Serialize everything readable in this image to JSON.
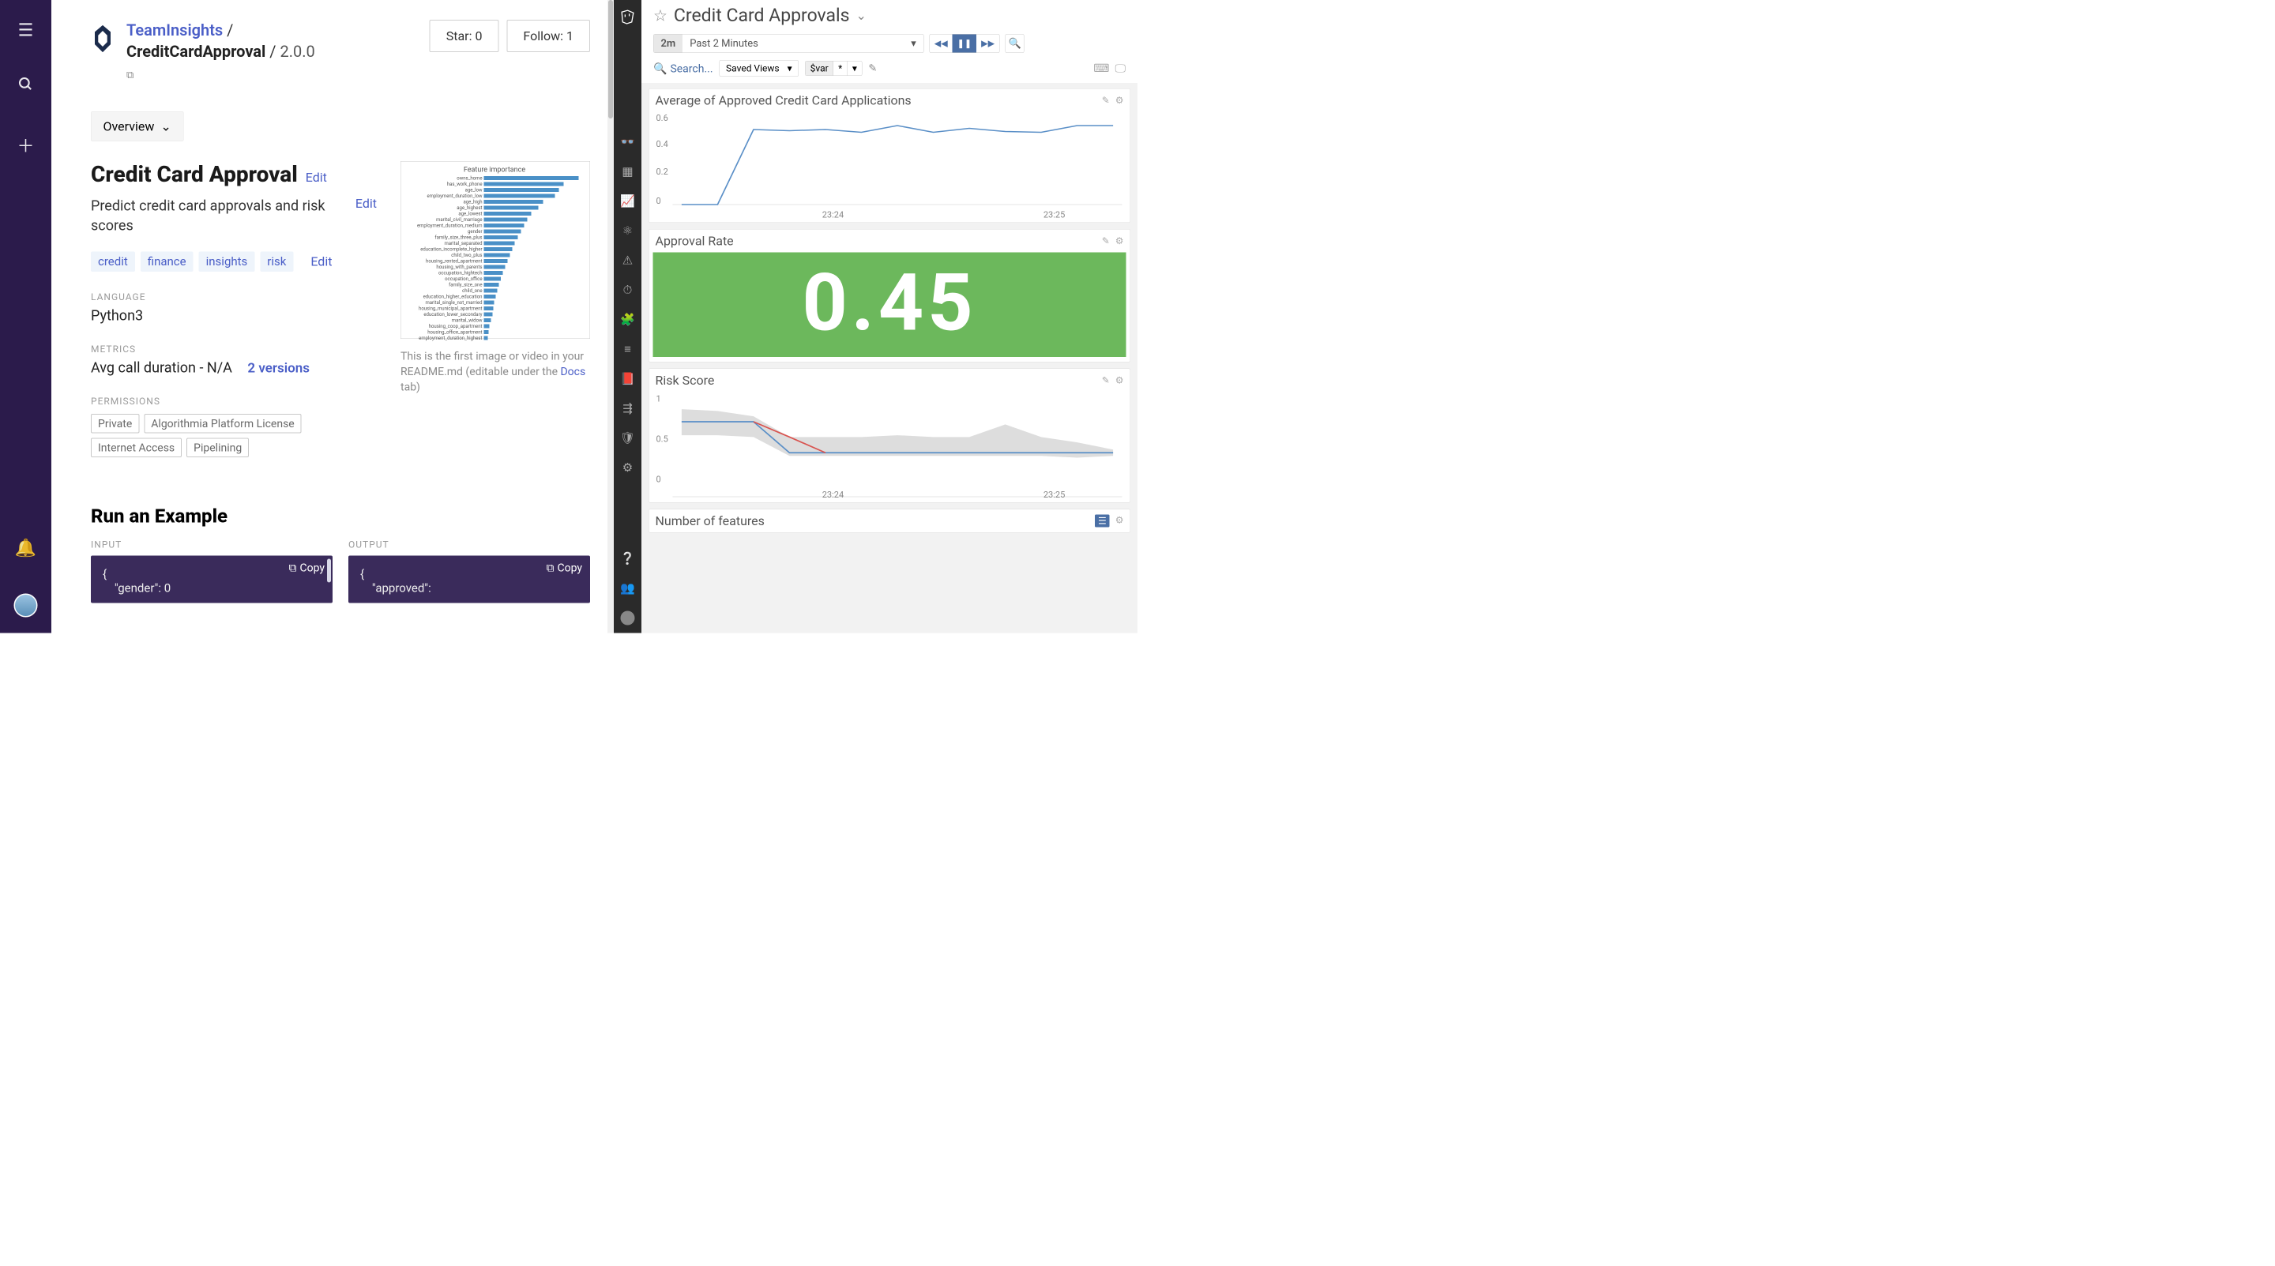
{
  "leftApp": {
    "breadcrumb": {
      "org": "TeamInsights",
      "sep": "/",
      "name": "CreditCardApproval",
      "version": "2.0.0"
    },
    "buttons": {
      "star": "Star: 0",
      "follow": "Follow: 1"
    },
    "overview_label": "Overview",
    "title": "Credit Card Approval",
    "edit": "Edit",
    "description": "Predict credit card approvals and risk scores",
    "tags": [
      "credit",
      "finance",
      "insights",
      "risk"
    ],
    "labels": {
      "language": "LANGUAGE",
      "metrics": "METRICS",
      "permissions": "PERMISSIONS",
      "input": "INPUT",
      "output": "OUTPUT"
    },
    "language": "Python3",
    "metrics_text": "Avg call duration - N/A",
    "versions_link": "2 versions",
    "permissions": [
      "Private",
      "Algorithmia Platform License",
      "Internet Access",
      "Pipelining"
    ],
    "run_title": "Run an Example",
    "copy": "Copy",
    "code_input": "{\n    \"gender\": 0",
    "code_output": "{\n    \"approved\":",
    "feature_chart": {
      "title": "Feature importance",
      "features": [
        {
          "name": "owns_home",
          "v": 0.2
        },
        {
          "name": "has_work_phone",
          "v": 0.168
        },
        {
          "name": "age_low",
          "v": 0.158
        },
        {
          "name": "employment_duration_low",
          "v": 0.15
        },
        {
          "name": "age_high",
          "v": 0.125
        },
        {
          "name": "age_highest",
          "v": 0.115
        },
        {
          "name": "age_lowest",
          "v": 0.1
        },
        {
          "name": "marital_civil_marriage",
          "v": 0.092
        },
        {
          "name": "employment_duration_medium",
          "v": 0.085
        },
        {
          "name": "gender",
          "v": 0.078
        },
        {
          "name": "family_size_three_plus",
          "v": 0.072
        },
        {
          "name": "marital_separated",
          "v": 0.065
        },
        {
          "name": "education_incomplete_higher",
          "v": 0.06
        },
        {
          "name": "child_two_plus",
          "v": 0.055
        },
        {
          "name": "housing_rented_apartment",
          "v": 0.05
        },
        {
          "name": "housing_with_parents",
          "v": 0.045
        },
        {
          "name": "occupation_hightech",
          "v": 0.04
        },
        {
          "name": "occupation_office",
          "v": 0.036
        },
        {
          "name": "family_size_one",
          "v": 0.032
        },
        {
          "name": "child_one",
          "v": 0.028
        },
        {
          "name": "education_higher_education",
          "v": 0.025
        },
        {
          "name": "marital_single_not_married",
          "v": 0.022
        },
        {
          "name": "housing_municipal_apartment",
          "v": 0.02
        },
        {
          "name": "education_lower_secondary",
          "v": 0.018
        },
        {
          "name": "marital_widow",
          "v": 0.015
        },
        {
          "name": "housing_coop_apartment",
          "v": 0.012
        },
        {
          "name": "housing_office_apartment",
          "v": 0.01
        },
        {
          "name": "employment_duration_highest",
          "v": 0.008
        }
      ],
      "caption_pre": "This is the first image or video in your README.md (editable under the ",
      "caption_link": "Docs",
      "caption_post": " tab)"
    }
  },
  "dd": {
    "title": "Credit Card Approvals",
    "time_short": "2m",
    "time_label": "Past 2 Minutes",
    "search": "Search...",
    "saved_views": "Saved Views",
    "var": "$var",
    "star": "*",
    "widgets": {
      "avg": "Average of Approved Credit Card Applications",
      "rate": "Approval Rate",
      "rate_value": "0.45",
      "risk": "Risk Score",
      "features": "Number of features"
    }
  },
  "chart_data": [
    {
      "type": "bar",
      "title": "Feature importance",
      "categories": [
        "owns_home",
        "has_work_phone",
        "age_low",
        "employment_duration_low",
        "age_high",
        "age_highest",
        "age_lowest",
        "marital_civil_marriage",
        "employment_duration_medium",
        "gender",
        "family_size_three_plus",
        "marital_separated",
        "education_incomplete_higher",
        "child_two_plus",
        "housing_rented_apartment",
        "housing_with_parents",
        "occupation_hightech",
        "occupation_office",
        "family_size_one",
        "child_one",
        "education_higher_education",
        "marital_single_not_married",
        "housing_municipal_apartment",
        "education_lower_secondary",
        "marital_widow",
        "housing_coop_apartment",
        "housing_office_apartment",
        "employment_duration_highest"
      ],
      "values": [
        0.2,
        0.168,
        0.158,
        0.15,
        0.125,
        0.115,
        0.1,
        0.092,
        0.085,
        0.078,
        0.072,
        0.065,
        0.06,
        0.055,
        0.05,
        0.045,
        0.04,
        0.036,
        0.032,
        0.028,
        0.025,
        0.022,
        0.02,
        0.018,
        0.015,
        0.012,
        0.01,
        0.008
      ],
      "xlabel": "",
      "ylabel": "",
      "xlim": [
        0,
        0.2
      ]
    },
    {
      "type": "line",
      "title": "Average of Approved Credit Card Applications",
      "x": [
        "23:24-60",
        "23:24-45",
        "23:24-30",
        "23:24-15",
        "23:24",
        "23:24+15",
        "23:24+30",
        "23:24+45",
        "23:25",
        "23:25+15",
        "23:25+30",
        "23:25+45",
        "23:25+60"
      ],
      "values": [
        0,
        0,
        0.5,
        0.49,
        0.5,
        0.48,
        0.52,
        0.48,
        0.51,
        0.49,
        0.48,
        0.52,
        0.52
      ],
      "ylim": [
        0,
        0.6
      ],
      "xticks": [
        "23:24",
        "23:25"
      ],
      "yticks": [
        0,
        0.2,
        0.4,
        0.6
      ]
    },
    {
      "type": "line",
      "title": "Risk Score",
      "series": [
        {
          "name": "band_upper",
          "values": [
            0.88,
            0.86,
            0.8,
            0.6,
            0.6,
            0.6,
            0.62,
            0.6,
            0.6,
            0.72,
            0.6,
            0.55,
            0.48
          ]
        },
        {
          "name": "band_lower",
          "values": [
            0.62,
            0.62,
            0.6,
            0.42,
            0.42,
            0.42,
            0.42,
            0.42,
            0.42,
            0.42,
            0.42,
            0.4,
            0.42
          ]
        },
        {
          "name": "blue",
          "values": [
            0.75,
            0.75,
            0.75,
            0.45,
            0.45,
            0.45,
            0.45,
            0.45,
            0.45,
            0.45,
            0.45,
            0.45,
            0.45
          ]
        },
        {
          "name": "red",
          "values": [
            null,
            null,
            0.75,
            0.6,
            0.45,
            null,
            null,
            null,
            null,
            null,
            null,
            null,
            null
          ]
        }
      ],
      "x": [
        "23:24-60",
        "23:24-45",
        "23:24-30",
        "23:24-15",
        "23:24",
        "23:24+15",
        "23:24+30",
        "23:24+45",
        "23:25",
        "23:25+15",
        "23:25+30",
        "23:25+45",
        "23:25+60"
      ],
      "ylim": [
        0,
        1
      ],
      "xticks": [
        "23:24",
        "23:25"
      ],
      "yticks": [
        0,
        0.5,
        1
      ]
    }
  ]
}
